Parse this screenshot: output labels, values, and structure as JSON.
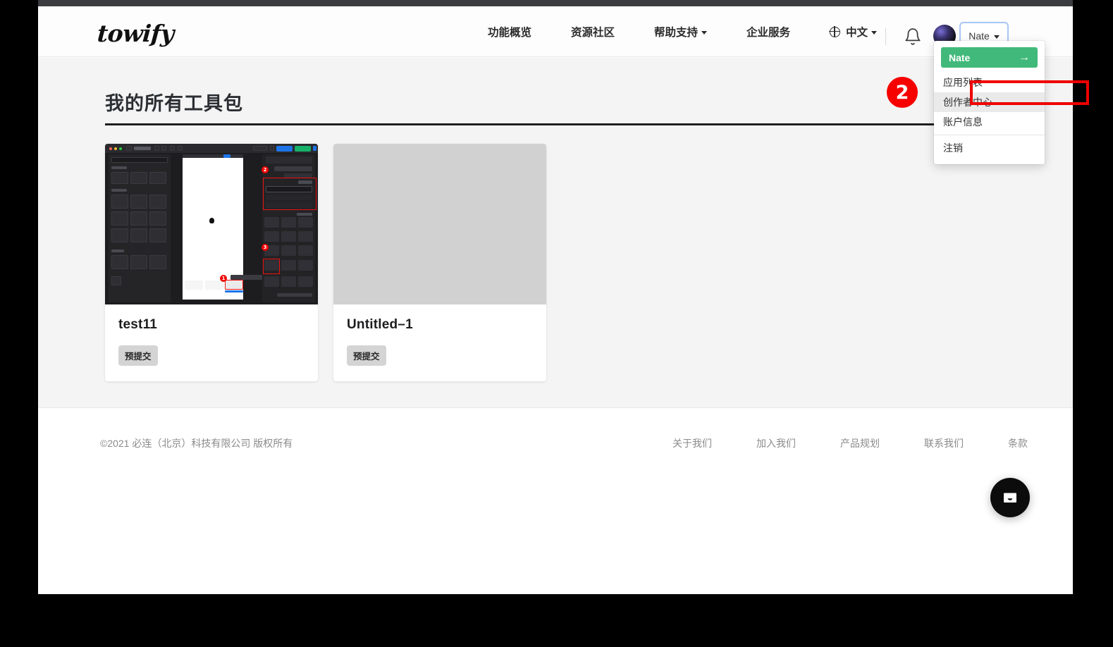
{
  "header": {
    "logo": "towify",
    "nav": [
      {
        "label": "功能概览",
        "has_caret": false,
        "icon": null
      },
      {
        "label": "资源社区",
        "has_caret": false,
        "icon": null
      },
      {
        "label": "帮助支持",
        "has_caret": true,
        "icon": null
      },
      {
        "label": "企业服务",
        "has_caret": false,
        "icon": null
      },
      {
        "label": "中文",
        "has_caret": true,
        "icon": "globe-icon"
      }
    ],
    "bell_icon": "bell-icon",
    "avatar": "user-avatar",
    "user_button_label": "Nate",
    "user_button_caret": "chevron-down-icon"
  },
  "user_dropdown": {
    "greeting": "Nate",
    "greeting_arrow": "→",
    "items": [
      {
        "label": "应用列表",
        "active": false
      },
      {
        "label": "创作者中心",
        "active": true
      },
      {
        "label": "账户信息",
        "active": false
      },
      {
        "label": "注销",
        "active": false
      }
    ]
  },
  "annotation": {
    "badge_number": "2",
    "badge_color": "#f60000",
    "highlight_color": "#ef0000",
    "highlight_target": "创作者中心"
  },
  "main": {
    "title": "我的所有工具包",
    "cards": [
      {
        "title": "test11",
        "badge": "预提交",
        "thumbnail": "design-editor-screenshot"
      },
      {
        "title": "Untitled–1",
        "badge": "预提交",
        "thumbnail": "empty-placeholder"
      }
    ]
  },
  "footer": {
    "copyright": "©2021 必连（北京）科技有限公司 版权所有",
    "links": [
      "关于我们",
      "加入我们",
      "产品规划",
      "联系我们",
      "条款"
    ]
  },
  "chat": {
    "icon": "inbox-message-icon"
  },
  "colors": {
    "accent_green": "#41b97a",
    "accent_blue": "#1a73f0",
    "page_bg": "#f4f4f4",
    "annotation_red": "#ef0000"
  }
}
